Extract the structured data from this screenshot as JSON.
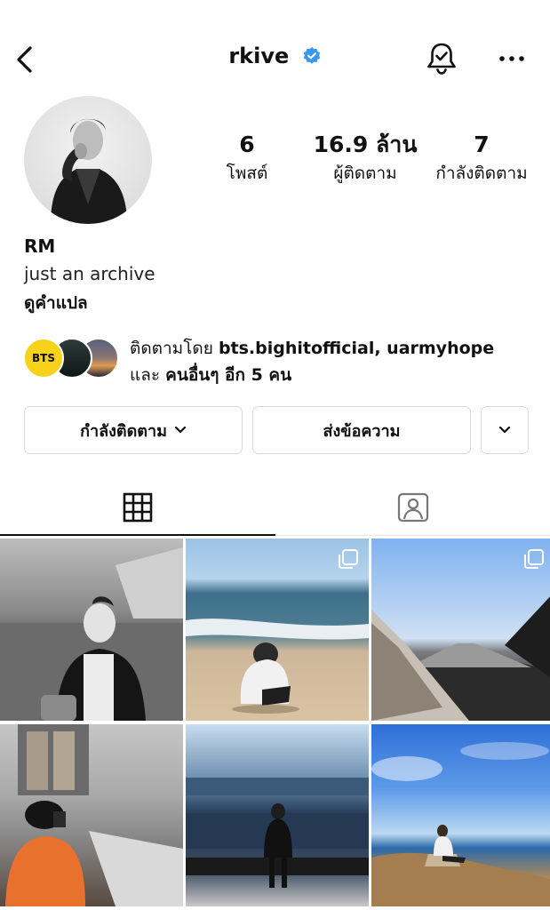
{
  "header": {
    "username": "rkive",
    "verified": true,
    "icons": {
      "back": "chevron-left-icon",
      "verified": "verified-badge-icon",
      "notifications": "bell-check-icon",
      "more": "more-horizontal-icon"
    }
  },
  "profile": {
    "stats": [
      {
        "value": "6",
        "label": "โพสต์"
      },
      {
        "value": "16.9 ล้าน",
        "label": "ผู้ติดตาม"
      },
      {
        "value": "7",
        "label": "กำลังติดตาม"
      }
    ],
    "name": "RM",
    "bio": "just an archive",
    "translate_label": "ดูคำแปล"
  },
  "followed_by": {
    "prefix": "ติดตามโดย ",
    "accounts": "bts.bighitofficial, uarmyhope",
    "and": "และ ",
    "others": "คนอื่นๆ อีก 5 คน",
    "avatar1_text": "BTS"
  },
  "actions": {
    "following_label": "กำลังติดตาม",
    "message_label": "ส่งข้อความ"
  },
  "tabs": [
    {
      "name": "grid",
      "icon": "grid-icon",
      "active": true
    },
    {
      "name": "tagged",
      "icon": "tagged-person-icon",
      "active": false
    }
  ],
  "colors": {
    "verified": "#3897f0",
    "bts_badge": "#f6d21a",
    "border": "#d8d8d8"
  }
}
